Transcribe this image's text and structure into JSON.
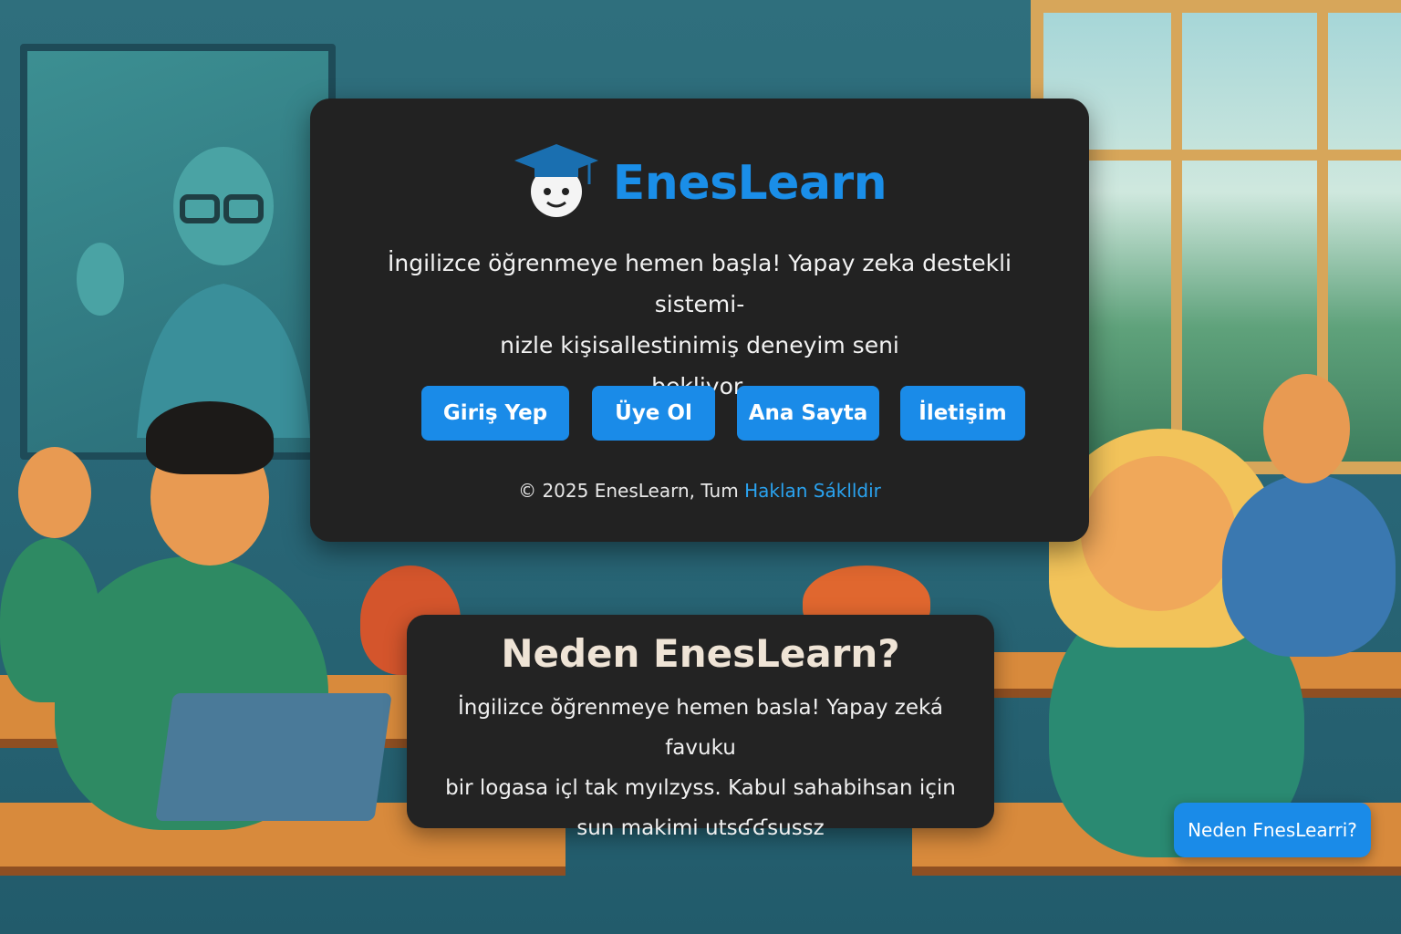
{
  "brand": {
    "name": "EnesLearn",
    "logo_icon": "student-graduation-cap-icon",
    "accent_color": "#1a8ee8"
  },
  "hero": {
    "lines": [
      "İngilizce öğrenmeye hemen başla! Yapay zeka destekli sistemi-",
      "nizle kişisallestinimiş deneyim seni",
      "bekliyor."
    ]
  },
  "buttons": [
    {
      "label": "Giriş Yep"
    },
    {
      "label": "Üye Ol"
    },
    {
      "label": "Ana Sayta"
    },
    {
      "label": "İletişim"
    }
  ],
  "footer": {
    "prefix": "© 2025 EnesLearn, Tum ",
    "link": "Haklan Sáklldir"
  },
  "why": {
    "title": "Neden EnesLearn?",
    "lines": [
      "İngilizce ŏğrenmeye hemen basla! Yapay zeká favuku",
      "bir logasa içl tak myılzyss. Kabul sahabihsan için",
      "sun makimi utsʛʛsussz"
    ]
  },
  "floating_button": {
    "label": "Neden FnesLearri?"
  }
}
